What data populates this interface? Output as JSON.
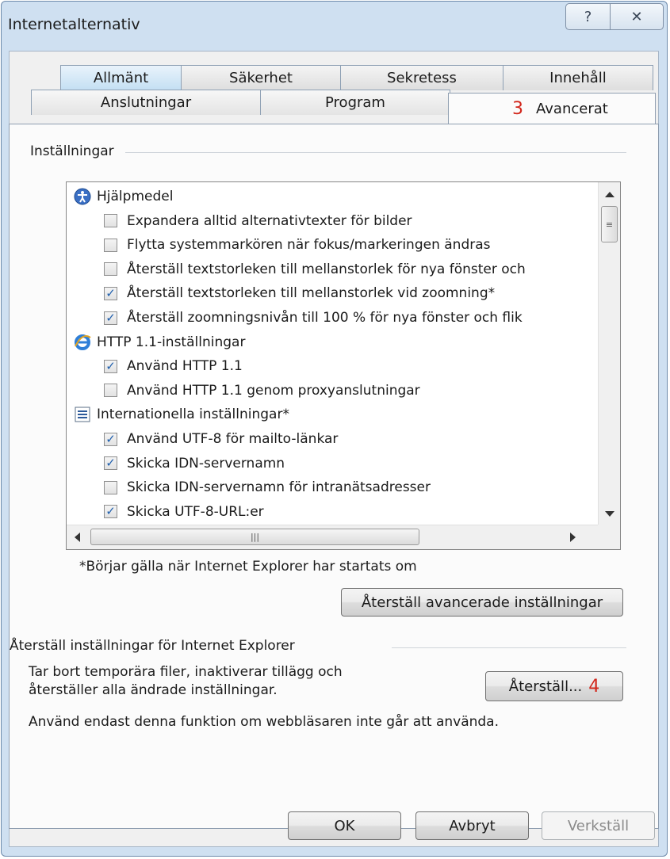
{
  "window": {
    "title": "Internetalternativ",
    "help_glyph": "?",
    "close_glyph": "✕"
  },
  "tabs": {
    "row1": [
      "Allmänt",
      "Säkerhet",
      "Sekretess",
      "Innehåll"
    ],
    "row2": [
      "Anslutningar",
      "Program",
      "Avancerat"
    ],
    "active": "Avancerat",
    "active_marker": "3"
  },
  "settings": {
    "group_label": "Inställningar",
    "items": [
      {
        "kind": "category",
        "label": "Hjälpmedel",
        "icon": "accessibility-icon"
      },
      {
        "kind": "checkbox",
        "label": "Expandera alltid alternativtexter för bilder",
        "checked": false
      },
      {
        "kind": "checkbox",
        "label": "Flytta systemmarkören när fokus/markeringen ändras",
        "checked": false
      },
      {
        "kind": "checkbox",
        "label": "Återställ textstorleken till mellanstorlek för nya fönster och",
        "checked": false
      },
      {
        "kind": "checkbox",
        "label": "Återställ textstorleken till mellanstorlek vid zoomning*",
        "checked": true
      },
      {
        "kind": "checkbox",
        "label": "Återställ zoomningsnivån till 100 % för nya fönster och flik",
        "checked": true
      },
      {
        "kind": "category",
        "label": "HTTP 1.1-inställningar",
        "icon": "ie-icon"
      },
      {
        "kind": "checkbox",
        "label": "Använd HTTP 1.1",
        "checked": true
      },
      {
        "kind": "checkbox",
        "label": "Använd HTTP 1.1 genom proxyanslutningar",
        "checked": false
      },
      {
        "kind": "category",
        "label": "Internationella inställningar*",
        "icon": "list-icon"
      },
      {
        "kind": "checkbox",
        "label": "Använd UTF-8 för mailto-länkar",
        "checked": true
      },
      {
        "kind": "checkbox",
        "label": "Skicka IDN-servernamn",
        "checked": true
      },
      {
        "kind": "checkbox",
        "label": "Skicka IDN-servernamn för intranätsadresser",
        "checked": false
      },
      {
        "kind": "checkbox",
        "label": "Skicka UTF-8-URL:er",
        "checked": true
      }
    ],
    "footnote": "*Börjar gälla när Internet Explorer har startats om",
    "reset_advanced_label": "Återställ avancerade inställningar"
  },
  "reset_section": {
    "group_label": "Återställ inställningar för Internet Explorer",
    "description_line1": "Tar bort temporära filer, inaktiverar tillägg och",
    "description_line2": "återställer alla ändrade inställningar.",
    "button_label": "Återställ...",
    "button_marker": "4",
    "warning": "Använd endast denna funktion om webbläsaren inte går att använda."
  },
  "dialog_buttons": {
    "ok": "OK",
    "cancel": "Avbryt",
    "apply": "Verkställ"
  },
  "colors": {
    "marker": "#d2271c",
    "check": "#1f5fad",
    "frame": "#cfe0f1"
  }
}
